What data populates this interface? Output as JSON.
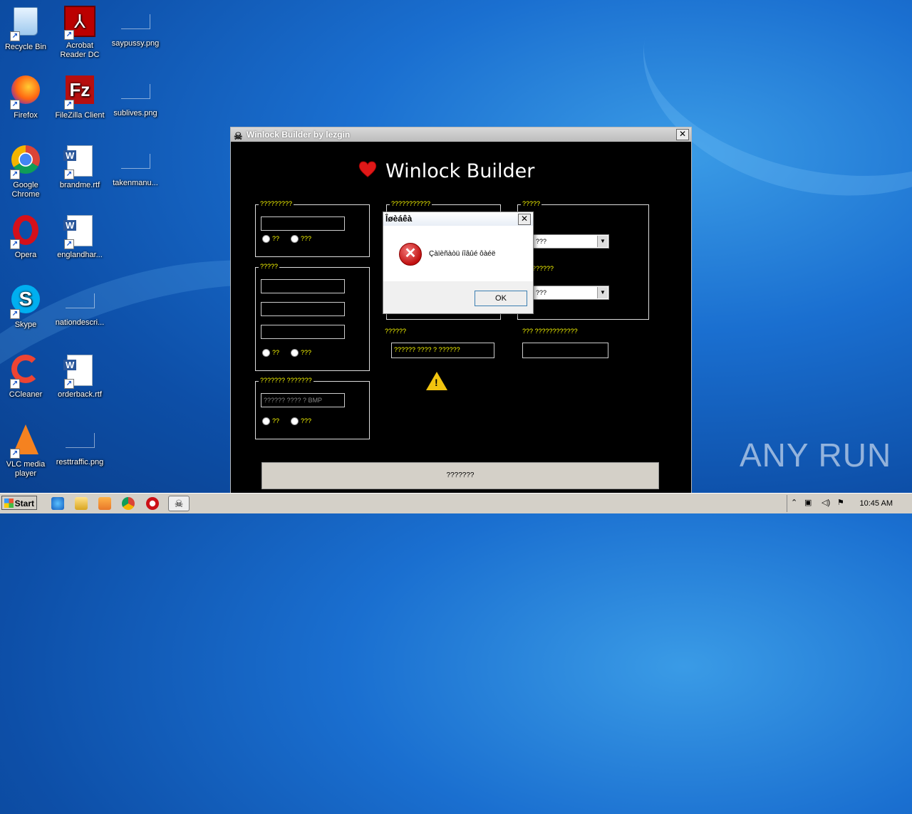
{
  "desktop_icons": [
    {
      "label": "Recycle Bin",
      "col": 0,
      "row": 0
    },
    {
      "label": "Acrobat Reader DC",
      "col": 1,
      "row": 0
    },
    {
      "label": "saypussy.png",
      "col": 2,
      "row": 0
    },
    {
      "label": "Firefox",
      "col": 0,
      "row": 1
    },
    {
      "label": "FileZilla Client",
      "col": 1,
      "row": 1
    },
    {
      "label": "sublives.png",
      "col": 2,
      "row": 1
    },
    {
      "label": "Google Chrome",
      "col": 0,
      "row": 2
    },
    {
      "label": "brandme.rtf",
      "col": 1,
      "row": 2
    },
    {
      "label": "takenmanu...",
      "col": 2,
      "row": 2
    },
    {
      "label": "Opera",
      "col": 0,
      "row": 3
    },
    {
      "label": "englandhar...",
      "col": 1,
      "row": 3
    },
    {
      "label": "Skype",
      "col": 0,
      "row": 4
    },
    {
      "label": "nationdescri...",
      "col": 1,
      "row": 4
    },
    {
      "label": "CCleaner",
      "col": 0,
      "row": 5
    },
    {
      "label": "orderback.rtf",
      "col": 1,
      "row": 5
    },
    {
      "label": "VLC media player",
      "col": 0,
      "row": 6
    },
    {
      "label": "resttraffic.png",
      "col": 1,
      "row": 6
    }
  ],
  "window": {
    "title": "Winlock Builder by lezgin",
    "heading": "Winlock Builder",
    "close_label": "✕",
    "group1": {
      "label": "?????????",
      "radio_a": "??",
      "radio_b": "???"
    },
    "group2": {
      "label": "?????",
      "radio_a": "??",
      "radio_b": "???"
    },
    "group3": {
      "label": "??????? ???????",
      "placeholder": "?????? ???? ? BMP",
      "radio_a": "??",
      "radio_b": "???"
    },
    "group4": {
      "label": "???????????"
    },
    "group5": {
      "label": "?????",
      "combo1_value": "???",
      "combo2_label": "??????",
      "combo2_value": "???"
    },
    "field_a": {
      "label": "??????",
      "placeholder": "?????? ???? ? ??????"
    },
    "field_b": {
      "label": "??? ????????????"
    },
    "build_button": "???????"
  },
  "dialog": {
    "title": "Îøèáêà",
    "message": "Çàïèñàòü íîâûé ôàéë",
    "ok_label": "OK"
  },
  "watermark": "ANY RUN",
  "taskbar": {
    "start_label": "Start",
    "clock": "10:45 AM"
  },
  "colors": {
    "accent_label": "#ffff00",
    "window_bg": "#000000",
    "desktop": "#1a6fd0"
  }
}
